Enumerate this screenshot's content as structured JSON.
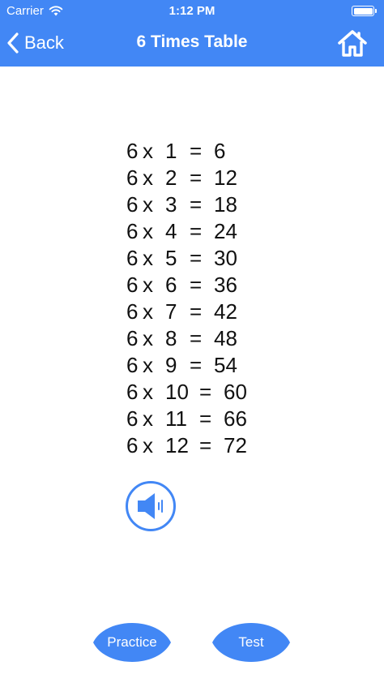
{
  "status_bar": {
    "carrier": "Carrier",
    "time": "1:12 PM"
  },
  "nav": {
    "back_label": "Back",
    "title": "6 Times Table"
  },
  "table": {
    "rows": [
      {
        "a": "6",
        "op": "x",
        "b": "1",
        "eq": "=",
        "result": "6"
      },
      {
        "a": "6",
        "op": "x",
        "b": "2",
        "eq": "=",
        "result": "12"
      },
      {
        "a": "6",
        "op": "x",
        "b": "3",
        "eq": "=",
        "result": "18"
      },
      {
        "a": "6",
        "op": "x",
        "b": "4",
        "eq": "=",
        "result": "24"
      },
      {
        "a": "6",
        "op": "x",
        "b": "5",
        "eq": "=",
        "result": "30"
      },
      {
        "a": "6",
        "op": "x",
        "b": "6",
        "eq": "=",
        "result": "36"
      },
      {
        "a": "6",
        "op": "x",
        "b": "7",
        "eq": "=",
        "result": "42"
      },
      {
        "a": "6",
        "op": "x",
        "b": "8",
        "eq": "=",
        "result": "48"
      },
      {
        "a": "6",
        "op": "x",
        "b": "9",
        "eq": "=",
        "result": "54"
      },
      {
        "a": "6",
        "op": "x",
        "b": "10",
        "eq": "=",
        "result": "60"
      },
      {
        "a": "6",
        "op": "x",
        "b": "11",
        "eq": "=",
        "result": "66"
      },
      {
        "a": "6",
        "op": "x",
        "b": "12",
        "eq": "=",
        "result": "72"
      }
    ]
  },
  "actions": {
    "practice_label": "Practice",
    "test_label": "Test"
  },
  "icons": {
    "back": "chevron-left-icon",
    "home": "home-icon",
    "speaker": "speaker-icon",
    "wifi": "wifi-icon",
    "battery": "battery-icon"
  },
  "colors": {
    "accent": "#4287f5",
    "text": "#111111",
    "background": "#ffffff"
  }
}
